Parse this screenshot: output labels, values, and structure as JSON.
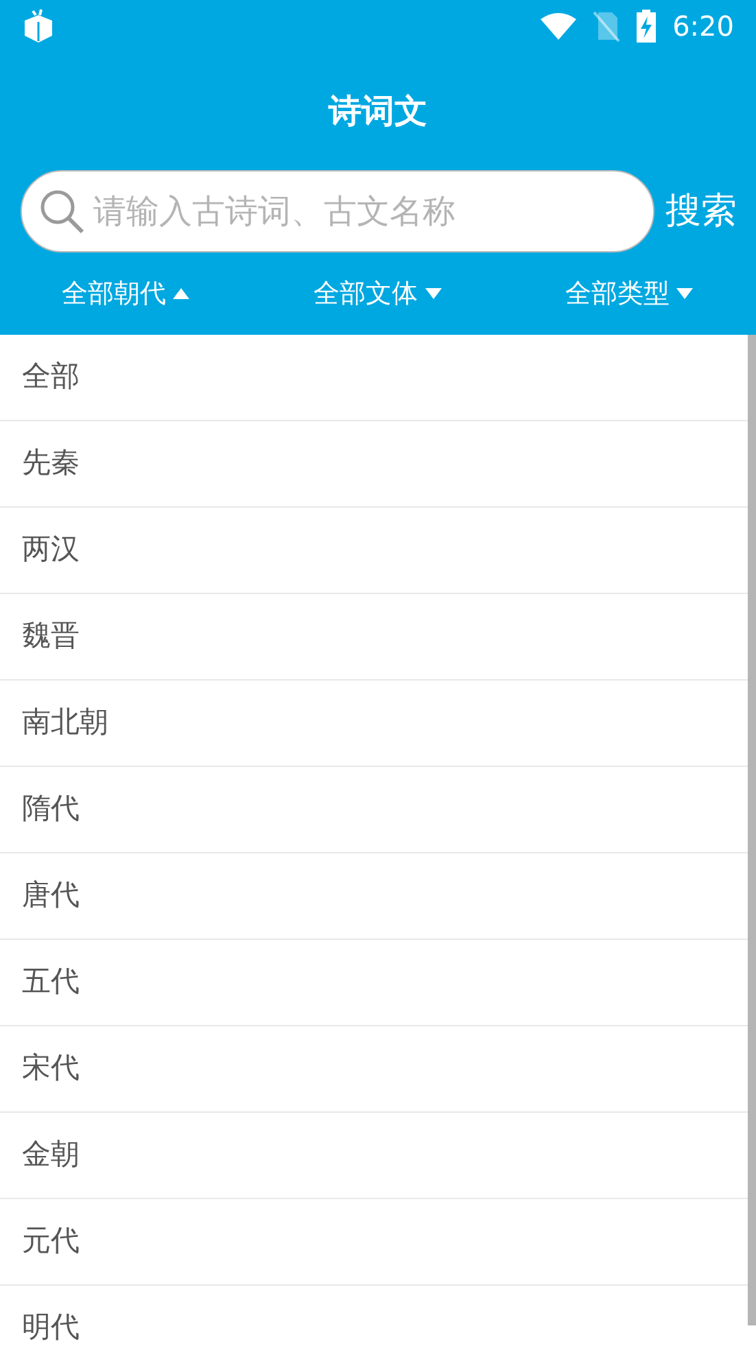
{
  "status_bar": {
    "time": "6:20"
  },
  "header": {
    "title": "诗词文"
  },
  "search": {
    "placeholder": "请输入古诗词、古文名称",
    "button": "搜索"
  },
  "filters": [
    {
      "label": "全部朝代",
      "expanded": true
    },
    {
      "label": "全部文体",
      "expanded": false
    },
    {
      "label": "全部类型",
      "expanded": false
    }
  ],
  "list": {
    "items": [
      {
        "label": "全部"
      },
      {
        "label": "先秦"
      },
      {
        "label": "两汉"
      },
      {
        "label": "魏晋"
      },
      {
        "label": "南北朝"
      },
      {
        "label": "隋代"
      },
      {
        "label": "唐代"
      },
      {
        "label": "五代"
      },
      {
        "label": "宋代"
      },
      {
        "label": "金朝"
      },
      {
        "label": "元代"
      },
      {
        "label": "明代"
      }
    ]
  }
}
